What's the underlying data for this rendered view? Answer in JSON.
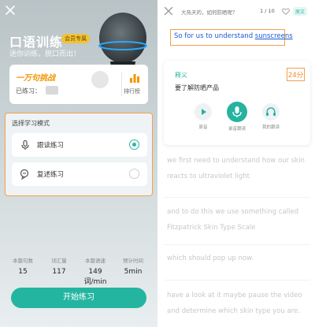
{
  "left": {
    "title": "口语训练",
    "badge": "会员专属",
    "subtitle": "迷你训练，脱口而出！",
    "challenge": {
      "title": "一万句挑战",
      "practiced_label": "已练习：",
      "rank_label": "排行榜"
    },
    "modes": {
      "title": "选择学习模式",
      "items": [
        {
          "label": "跟读练习",
          "selected": true
        },
        {
          "label": "复述练习",
          "selected": false
        }
      ]
    },
    "stats": [
      {
        "label": "本篇句数",
        "value": "15"
      },
      {
        "label": "词汇量",
        "value": "117"
      },
      {
        "label": "本篇语速",
        "value": "149词/min"
      },
      {
        "label": "预计时间",
        "value": "5min"
      }
    ],
    "start_button": "开始练习"
  },
  "right": {
    "question": "大热天的，如何防晒呢？",
    "page": "1 / 10",
    "tag": "原文",
    "sentence_prefix": "So for us to understand ",
    "sentence_keyword": "sunscreens",
    "definition": {
      "label": "释义",
      "text": "要了解防晒产品",
      "score": "24分"
    },
    "controls": [
      "原音",
      "录音跟读",
      "我的跟读"
    ],
    "paragraphs": [
      "we first need to understand how our skin reacts to ultraviolet light",
      "and to do this we use something called Fitzpatrick Skin Type Scale",
      "which should pop up now.",
      "have a look at it maybe pause the video and determine which skin type you are."
    ]
  },
  "colors": {
    "accent": "#24b5a0",
    "highlight_border": "#f5a04b",
    "sentence_blue": "#1a5bd0",
    "score_orange": "#f08a2b"
  }
}
